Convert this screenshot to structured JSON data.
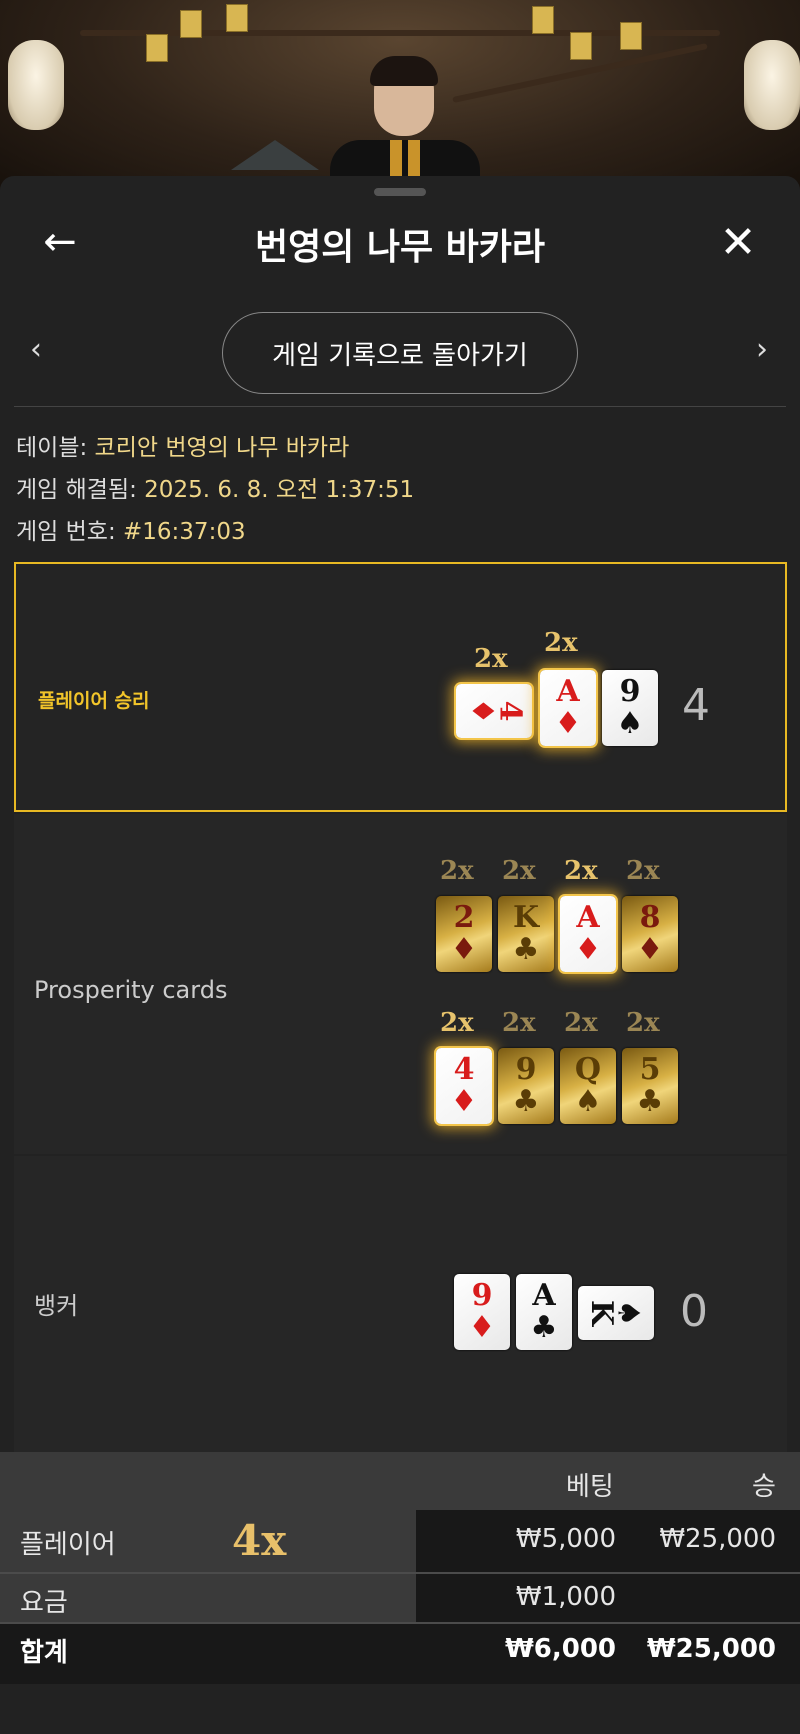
{
  "header": {
    "title": "번영의 나무 바카라",
    "back_icon": "←",
    "close_icon": "✕"
  },
  "nav": {
    "prev_icon": "‹",
    "next_icon": "›",
    "back_to_history": "게임 기록으로 돌아가기"
  },
  "info": {
    "table_label": "테이블: ",
    "table_value": "코리안 번영의 나무 바카라",
    "resolved_label": "게임 해결됨: ",
    "resolved_value": "2025. 6. 8. 오전 1:37:51",
    "game_no_label": "게임 번호: ",
    "game_no_value": "#16:37:03"
  },
  "player": {
    "label": "플레이어 승리",
    "score": "4",
    "cards": [
      {
        "rank": "4",
        "suit": "♦",
        "color": "red",
        "multiplier": "2x",
        "highlight": true,
        "sideways": true
      },
      {
        "rank": "A",
        "suit": "♦",
        "color": "red",
        "multiplier": "2x",
        "highlight": true
      },
      {
        "rank": "9",
        "suit": "♠",
        "color": "black",
        "multiplier": ""
      }
    ]
  },
  "prosperity": {
    "label": "Prosperity cards",
    "row1": [
      {
        "rank": "2",
        "suit": "♦",
        "mult": "2x",
        "active": false
      },
      {
        "rank": "K",
        "suit": "♣",
        "mult": "2x",
        "active": false
      },
      {
        "rank": "A",
        "suit": "♦",
        "mult": "2x",
        "active": true
      },
      {
        "rank": "8",
        "suit": "♦",
        "mult": "2x",
        "active": false
      }
    ],
    "row2": [
      {
        "rank": "4",
        "suit": "♦",
        "mult": "2x",
        "active": true
      },
      {
        "rank": "9",
        "suit": "♣",
        "mult": "2x",
        "active": false
      },
      {
        "rank": "Q",
        "suit": "♠",
        "mult": "2x",
        "active": false
      },
      {
        "rank": "5",
        "suit": "♣",
        "mult": "2x",
        "active": false
      }
    ]
  },
  "banker": {
    "label": "뱅커",
    "score": "0",
    "cards": [
      {
        "rank": "9",
        "suit": "♦",
        "color": "red"
      },
      {
        "rank": "A",
        "suit": "♣",
        "color": "black"
      },
      {
        "rank": "K",
        "suit": "♠",
        "color": "black",
        "sideways": true
      }
    ]
  },
  "bets": {
    "col_bet": "베팅",
    "col_win": "승",
    "rows": [
      {
        "name": "플레이어",
        "multiplier": "4x",
        "bet": "₩5,000",
        "win": "₩25,000"
      },
      {
        "name": "요금",
        "bet": "₩1,000",
        "win": ""
      },
      {
        "name": "합계",
        "bet": "₩6,000",
        "win": "₩25,000"
      }
    ]
  }
}
